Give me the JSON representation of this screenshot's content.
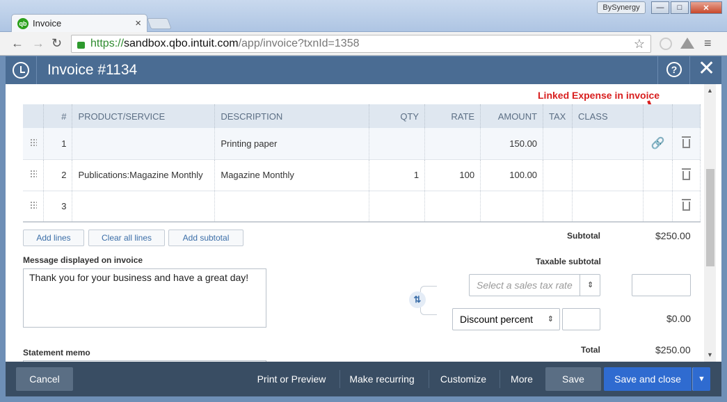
{
  "browser": {
    "tab_title": "Invoice",
    "tab_icon_text": "qb",
    "profile_label": "BySynergy",
    "url_scheme": "https://",
    "url_host": "sandbox.qbo.intuit.com",
    "url_path": "/app/invoice?txnId=1358"
  },
  "header": {
    "title": "Invoice #1134",
    "help_label": "?"
  },
  "annotation": "Linked Expense in invoice",
  "table": {
    "columns": [
      "#",
      "PRODUCT/SERVICE",
      "DESCRIPTION",
      "QTY",
      "RATE",
      "AMOUNT",
      "TAX",
      "CLASS"
    ],
    "rows": [
      {
        "num": "1",
        "product": "",
        "description": "Printing paper",
        "qty": "",
        "rate": "",
        "amount": "150.00",
        "linked": true
      },
      {
        "num": "2",
        "product": "Publications:Magazine Monthly",
        "description": "Magazine Monthly",
        "qty": "1",
        "rate": "100",
        "amount": "100.00",
        "linked": false
      },
      {
        "num": "3",
        "product": "",
        "description": "",
        "qty": "",
        "rate": "",
        "amount": "",
        "linked": false
      }
    ]
  },
  "actions": {
    "add_lines": "Add lines",
    "clear_all_lines": "Clear all lines",
    "add_subtotal": "Add subtotal"
  },
  "totals": {
    "subtotal_label": "Subtotal",
    "subtotal_value": "$250.00",
    "taxable_subtotal_label": "Taxable subtotal",
    "tax_rate_placeholder": "Select a sales tax rate",
    "discount_option": "Discount percent",
    "discount_value": "$0.00",
    "total_label": "Total",
    "total_value": "$250.00"
  },
  "message": {
    "label": "Message displayed on invoice",
    "value": "Thank you for your business and have a great day!"
  },
  "statement_memo_label": "Statement memo",
  "footer": {
    "cancel": "Cancel",
    "print_preview": "Print or Preview",
    "make_recurring": "Make recurring",
    "customize": "Customize",
    "more": "More",
    "save": "Save",
    "save_and_close": "Save and close"
  },
  "colors": {
    "header_bg": "#4a6c93",
    "footer_bg": "#394d63",
    "primary_button": "#2f6bd0",
    "annotation": "#d81e1e"
  }
}
